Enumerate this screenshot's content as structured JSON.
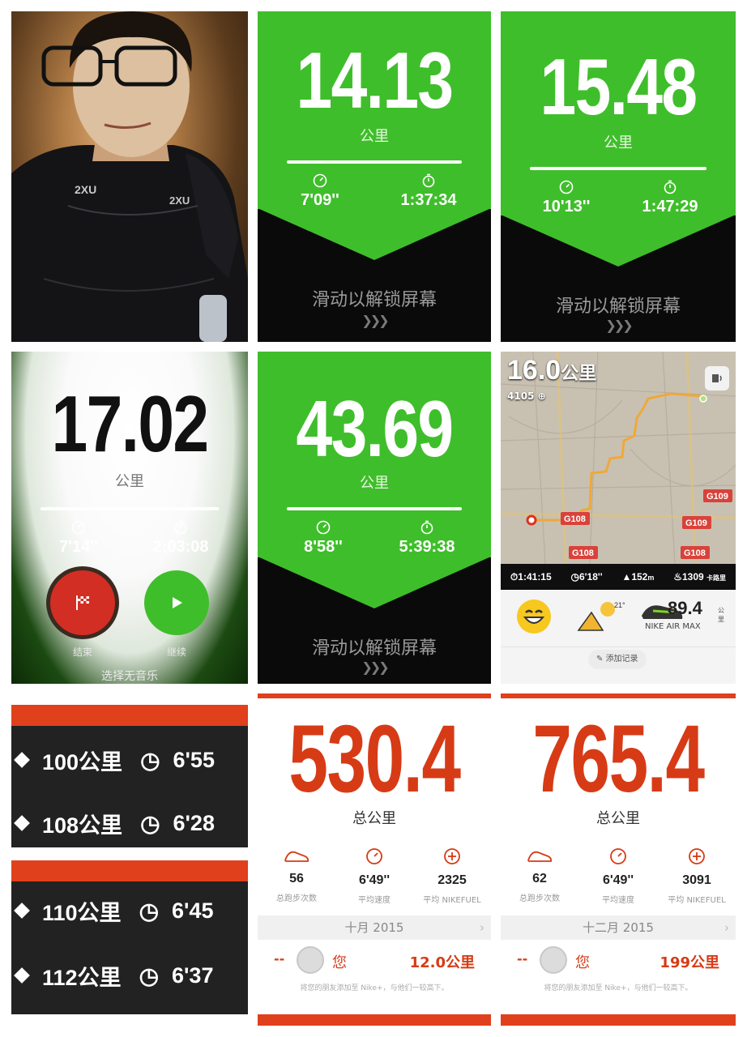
{
  "photo": {
    "shirt_logo_1": "2XU",
    "shirt_logo_2": "2XU"
  },
  "runs": [
    {
      "distance": "14.13",
      "unit": "公里",
      "pace": "7'09''",
      "duration": "1:37:34",
      "lock_text": "滑动以解锁屏幕",
      "chevrons": "❯❯❯"
    },
    {
      "distance": "15.48",
      "unit": "公里",
      "pace": "10'13''",
      "duration": "1:47:29",
      "lock_text": "滑动以解锁屏幕",
      "chevrons": "❯❯❯"
    },
    {
      "distance": "43.69",
      "unit": "公里",
      "pace": "8'58''",
      "duration": "5:39:38",
      "lock_text": "滑动以解锁屏幕",
      "chevrons": "❯❯❯"
    }
  ],
  "paused_run": {
    "distance": "17.02",
    "unit": "公里",
    "pace": "7'14''",
    "duration": "2:03:08",
    "end_label": "结束",
    "resume_label": "继续",
    "music_label": "选择无音乐"
  },
  "map_card": {
    "distance_value": "16.0",
    "distance_unit": "公里",
    "fuel_value": "4105",
    "road_labels": [
      "G109",
      "G108",
      "G108",
      "G108",
      "G109"
    ],
    "stats": {
      "duration": "1:41:15",
      "pace": "6'18''",
      "elevation": "152",
      "elevation_unit": "m",
      "calories": "1309",
      "calories_unit": "卡路里"
    },
    "temperature": "21°",
    "shoe_distance": "89.4",
    "shoe_unit": "公里",
    "shoe_name": "NIKE AIR MAX",
    "add_note_label": "添加记录"
  },
  "splits": [
    {
      "label": "100公里",
      "pace": "6'55"
    },
    {
      "label": "108公里",
      "pace": "6'28"
    },
    {
      "label": "110公里",
      "pace": "6'45"
    },
    {
      "label": "112公里",
      "pace": "6'37"
    }
  ],
  "totals": [
    {
      "total": "530.4",
      "total_label": "总公里",
      "runs_value": "56",
      "runs_label": "总跑步次数",
      "pace_value": "6'49''",
      "pace_label": "平均速度",
      "fuel_value": "2325",
      "fuel_label": "平均 NIKEFUEL",
      "month": "十月 2015",
      "dash": "--",
      "you": "您",
      "friend_km": "12.0公里",
      "invite": "将您的朋友添加至 Nike+，与他们一较高下。"
    },
    {
      "total": "765.4",
      "total_label": "总公里",
      "runs_value": "62",
      "runs_label": "总跑步次数",
      "pace_value": "6'49''",
      "pace_label": "平均速度",
      "fuel_value": "3091",
      "fuel_label": "平均 NIKEFUEL",
      "month": "十二月 2015",
      "dash": "--",
      "you": "您",
      "friend_km": "199公里",
      "invite": "将您的朋友添加至 Nike+，与他们一较高下。"
    }
  ],
  "colors": {
    "nike_green": "#3fbe2b",
    "nike_red": "#d63b16",
    "dark": "#0a0a0a"
  }
}
